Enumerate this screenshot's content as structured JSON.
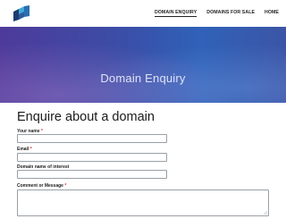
{
  "nav": {
    "items": [
      {
        "label": "DOMAIN ENQUIRY",
        "active": true
      },
      {
        "label": "DOMAINS FOR SALE",
        "active": false
      },
      {
        "label": "HOME",
        "active": false
      }
    ]
  },
  "hero": {
    "title": "Domain Enquiry"
  },
  "form": {
    "title": "Enquire about a domain",
    "name_label": "Your name",
    "email_label": "Email",
    "domain_label": "Domain name of interest",
    "comment_label": "Comment or Message",
    "required_mark": "*",
    "name_value": "",
    "email_value": "",
    "domain_value": "",
    "comment_value": ""
  },
  "colors": {
    "hero_start": "#4e3a9a",
    "hero_end": "#2f62b8",
    "logo_dark": "#1f3b70",
    "logo_light": "#3fa9d8",
    "required": "#d0312d"
  }
}
